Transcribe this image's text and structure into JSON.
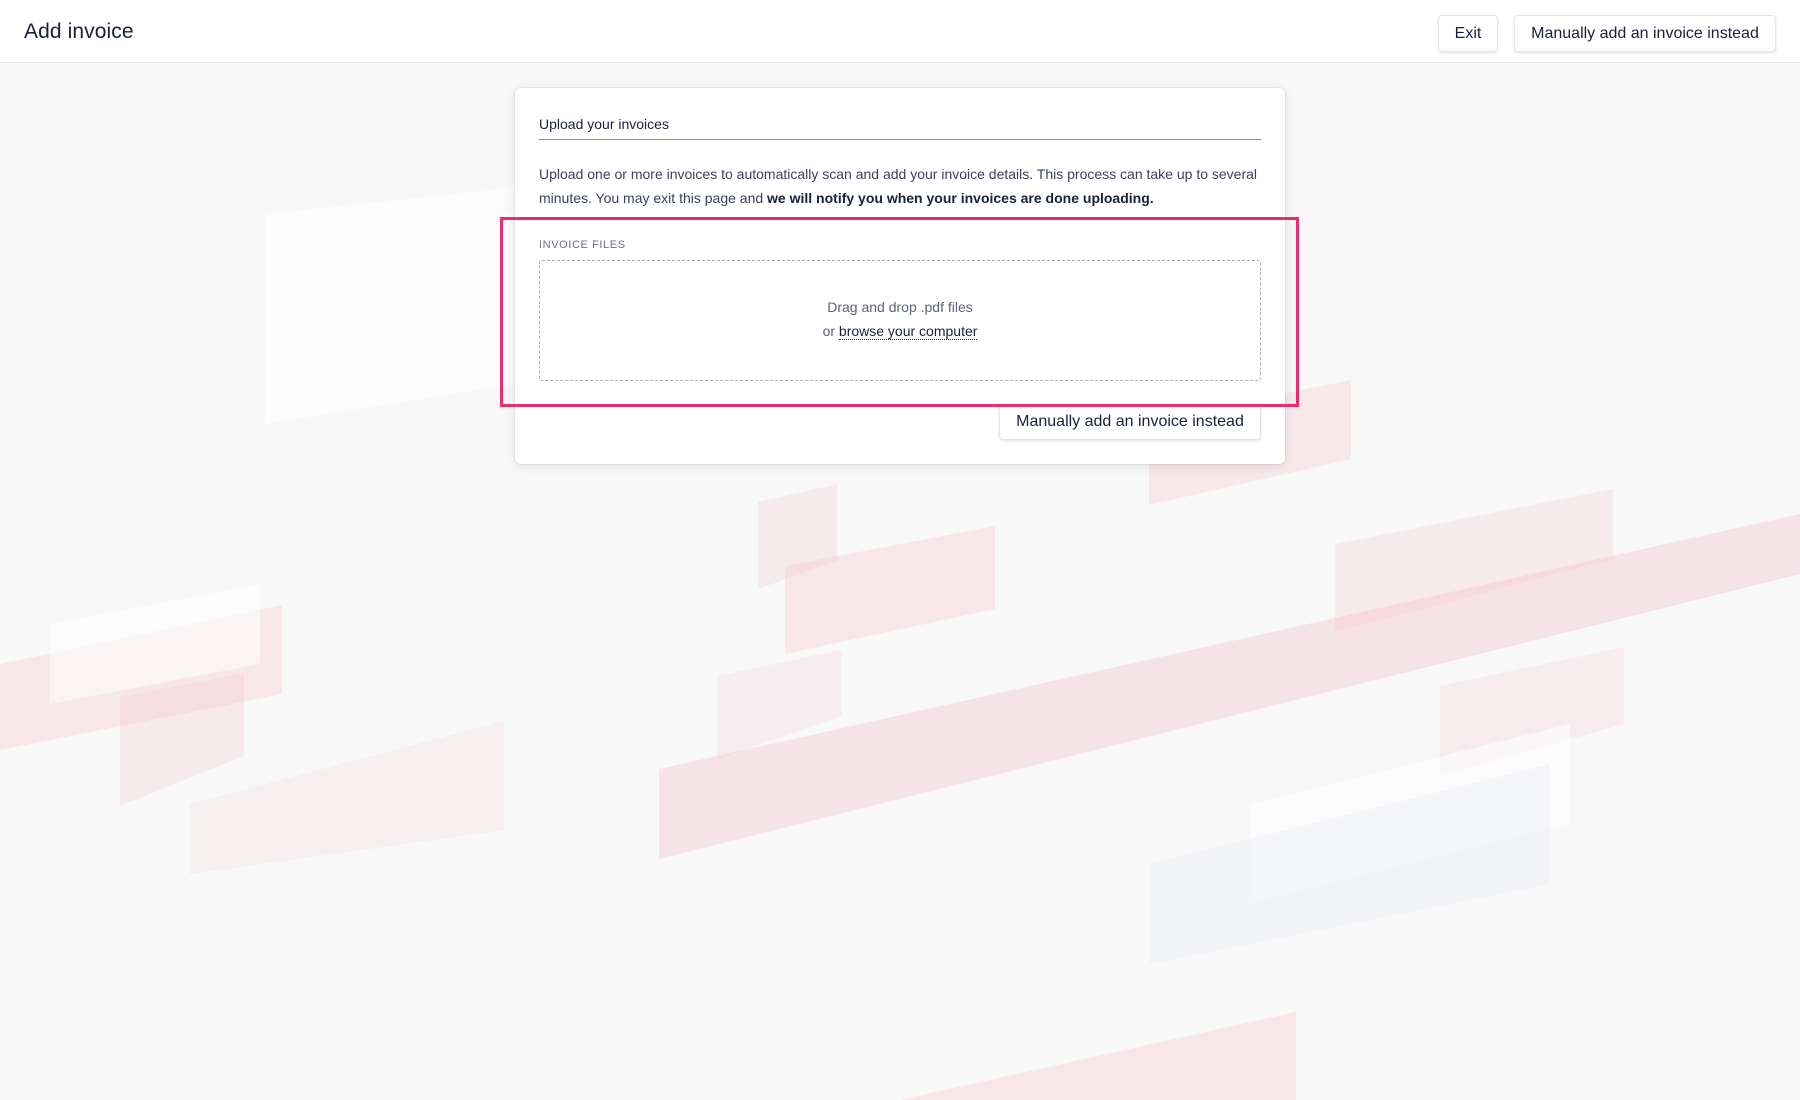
{
  "header": {
    "title": "Add invoice",
    "exit_label": "Exit",
    "manual_label": "Manually add an invoice instead"
  },
  "card": {
    "title": "Upload your invoices",
    "description_plain": "Upload one or more invoices to automatically scan and add your invoice details. This process can take up to several minutes. You may exit this page and ",
    "description_bold": "we will notify you when your invoices are done uploading.",
    "field_label": "INVOICE FILES",
    "dropzone_text": "Drag and drop .pdf files",
    "dropzone_or": "or ",
    "browse_link": "browse your computer",
    "manual_label": "Manually add an invoice instead"
  },
  "colors": {
    "highlight": "#ec2d6b",
    "text_primary": "#18203d",
    "background": "#f8f8f9",
    "decor_pink": "#f6c9cf"
  },
  "icons": []
}
